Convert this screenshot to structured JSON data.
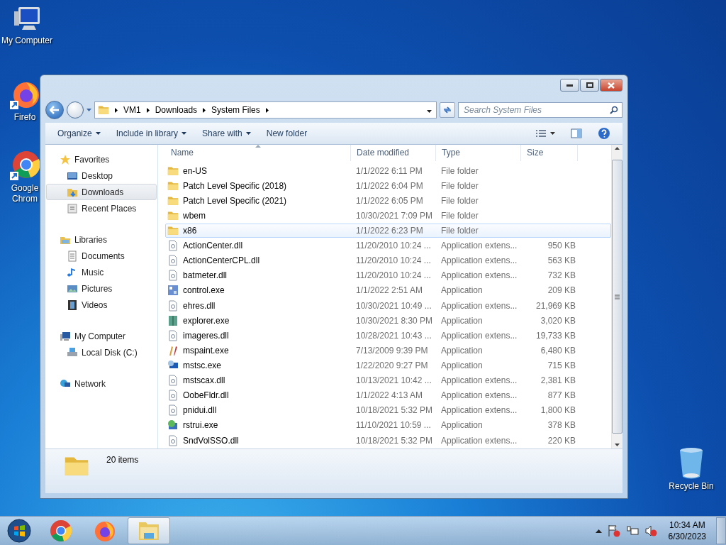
{
  "desktop_icons": [
    {
      "label": "My Computer",
      "kind": "computer"
    },
    {
      "label": "Firefo",
      "kind": "firefox"
    },
    {
      "label": "Google Chrom",
      "kind": "chrome"
    },
    {
      "label": "Recycle Bin",
      "kind": "bin"
    }
  ],
  "window": {
    "address": {
      "path": [
        "VM1",
        "Downloads",
        "System Files"
      ]
    },
    "search": {
      "placeholder": "Search System Files"
    },
    "toolbar": [
      {
        "label": "Organize",
        "menu": true
      },
      {
        "label": "Include in library",
        "menu": true
      },
      {
        "label": "Share with",
        "menu": true
      },
      {
        "label": "New folder",
        "menu": false
      }
    ],
    "sidebar": [
      {
        "label": "Favorites",
        "kind": "star",
        "selected": false,
        "children": [
          {
            "label": "Desktop",
            "kind": "desktop",
            "selected": false
          },
          {
            "label": "Downloads",
            "kind": "downloads",
            "selected": true
          },
          {
            "label": "Recent Places",
            "kind": "recent",
            "selected": false
          }
        ]
      },
      {
        "label": "Libraries",
        "kind": "libraries",
        "selected": false,
        "children": [
          {
            "label": "Documents",
            "kind": "documents",
            "selected": false
          },
          {
            "label": "Music",
            "kind": "music",
            "selected": false
          },
          {
            "label": "Pictures",
            "kind": "pictures",
            "selected": false
          },
          {
            "label": "Videos",
            "kind": "videos",
            "selected": false
          }
        ]
      },
      {
        "label": "My Computer",
        "kind": "computer",
        "selected": false,
        "children": [
          {
            "label": "Local Disk (C:)",
            "kind": "disk",
            "selected": false
          }
        ]
      },
      {
        "label": "Network",
        "kind": "network",
        "selected": false
      }
    ],
    "columns": [
      {
        "label": "Name",
        "sorted": true
      },
      {
        "label": "Date modified",
        "sorted": false
      },
      {
        "label": "Type",
        "sorted": false
      },
      {
        "label": "Size",
        "sorted": false
      }
    ],
    "rows": [
      {
        "kind": "folder",
        "name": "en-US",
        "date": "1/1/2022 6:11 PM",
        "type": "File folder",
        "hovered": false
      },
      {
        "kind": "folder",
        "name": "Patch Level Specific (2018)",
        "date": "1/1/2022 6:04 PM",
        "type": "File folder",
        "hovered": false
      },
      {
        "kind": "folder",
        "name": "Patch Level Specific (2021)",
        "date": "1/1/2022 6:05 PM",
        "type": "File folder",
        "hovered": false
      },
      {
        "kind": "folder",
        "name": "wbem",
        "date": "10/30/2021 7:09 PM",
        "type": "File folder",
        "hovered": false
      },
      {
        "kind": "folder",
        "name": "x86",
        "date": "1/1/2022 6:23 PM",
        "type": "File folder",
        "hovered": true
      },
      {
        "kind": "dll",
        "name": "ActionCenter.dll",
        "date": "11/20/2010 10:24 ...",
        "type": "Application extens...",
        "size": "950 KB",
        "hovered": false
      },
      {
        "kind": "dll",
        "name": "ActionCenterCPL.dll",
        "date": "11/20/2010 10:24 ...",
        "type": "Application extens...",
        "size": "563 KB",
        "hovered": false
      },
      {
        "kind": "dll",
        "name": "batmeter.dll",
        "date": "11/20/2010 10:24 ...",
        "type": "Application extens...",
        "size": "732 KB",
        "hovered": false
      },
      {
        "kind": "control",
        "name": "control.exe",
        "date": "1/1/2022 2:51 AM",
        "type": "Application",
        "size": "209 KB",
        "hovered": false
      },
      {
        "kind": "dll",
        "name": "ehres.dll",
        "date": "10/30/2021 10:49 ...",
        "type": "Application extens...",
        "size": "21,969 KB",
        "hovered": false
      },
      {
        "kind": "explorer",
        "name": "explorer.exe",
        "date": "10/30/2021 8:30 PM",
        "type": "Application",
        "size": "3,020 KB",
        "hovered": false
      },
      {
        "kind": "dll",
        "name": "imageres.dll",
        "date": "10/28/2021 10:43 ...",
        "type": "Application extens...",
        "size": "19,733 KB",
        "hovered": false
      },
      {
        "kind": "paint",
        "name": "mspaint.exe",
        "date": "7/13/2009 9:39 PM",
        "type": "Application",
        "size": "6,480 KB",
        "hovered": false
      },
      {
        "kind": "remote",
        "name": "mstsc.exe",
        "date": "1/22/2020 9:27 PM",
        "type": "Application",
        "size": "715 KB",
        "hovered": false
      },
      {
        "kind": "dll",
        "name": "mstscax.dll",
        "date": "10/13/2021 10:42 ...",
        "type": "Application extens...",
        "size": "2,381 KB",
        "hovered": false
      },
      {
        "kind": "dll",
        "name": "OobeFldr.dll",
        "date": "1/1/2022 4:13 AM",
        "type": "Application extens...",
        "size": "877 KB",
        "hovered": false
      },
      {
        "kind": "dll",
        "name": "pnidui.dll",
        "date": "10/18/2021 5:32 PM",
        "type": "Application extens...",
        "size": "1,800 KB",
        "hovered": false
      },
      {
        "kind": "restore",
        "name": "rstrui.exe",
        "date": "11/10/2021 10:59 ...",
        "type": "Application",
        "size": "378 KB",
        "hovered": false
      },
      {
        "kind": "dll",
        "name": "SndVolSSO.dll",
        "date": "10/18/2021 5:32 PM",
        "type": "Application extens...",
        "size": "220 KB",
        "hovered": false
      }
    ],
    "details": {
      "count": "20 items"
    }
  },
  "taskbar": {
    "items": [
      {
        "kind": "chrome",
        "active": false
      },
      {
        "kind": "firefox",
        "active": false
      },
      {
        "kind": "explorer",
        "active": true
      }
    ],
    "time": "10:34 AM",
    "date": "6/30/2023"
  }
}
